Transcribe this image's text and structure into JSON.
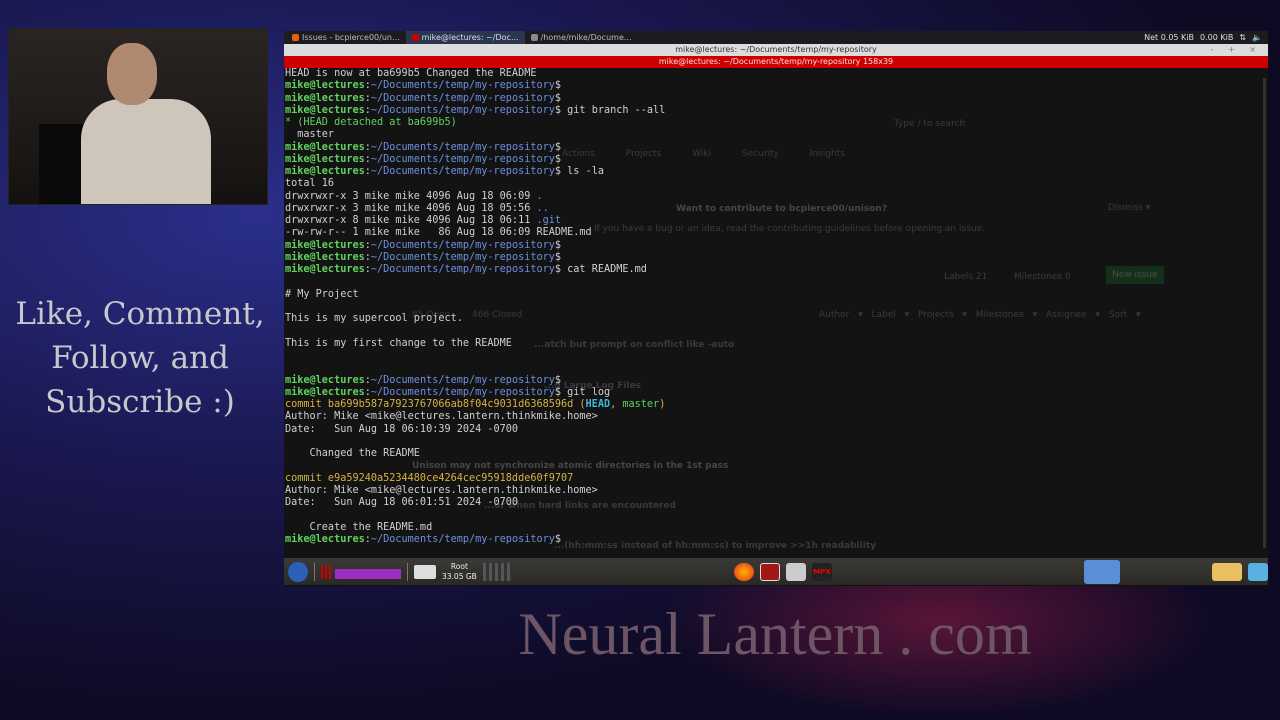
{
  "overlay": {
    "cta_lines": [
      "Like, Comment,",
      "Follow, and",
      "Subscribe :)"
    ],
    "brand": "Neural Lantern . com"
  },
  "topbar": {
    "tabs": [
      {
        "label": "Issues - bcpierce00/un...",
        "color": "#e66000"
      },
      {
        "label": "mike@lectures: ~/Doc...",
        "color": "#c00",
        "active": true
      },
      {
        "label": "/home/mike/Docume...",
        "color": "#888"
      }
    ],
    "tray": {
      "net": "Net 0.05 KiB",
      "net2": "0.00 KiB"
    }
  },
  "window": {
    "title": "mike@lectures: ~/Documents/temp/my-repository",
    "subtitle": "mike@lectures: ~/Documents/temp/my-repository 158x39",
    "controls": "- + ×"
  },
  "terminal": {
    "user": "mike@lectures",
    "path": "~/Documents/temp/my-repository",
    "lines": [
      [
        [
          "w",
          "HEAD is now at ba699b5 Changed the README"
        ]
      ],
      "P",
      "P",
      [
        "P",
        [
          "w",
          " git branch --all"
        ]
      ],
      [
        [
          "g",
          "* (HEAD detached at ba699b5)"
        ]
      ],
      [
        [
          "w",
          "  master"
        ]
      ],
      "P",
      "P",
      [
        "P",
        [
          "w",
          " ls -la"
        ]
      ],
      [
        [
          "w",
          "total 16"
        ]
      ],
      [
        [
          "w",
          "drwxrwxr-x 3 mike mike 4096 Aug 18 06:09 "
        ],
        [
          "b",
          "."
        ]
      ],
      [
        [
          "w",
          "drwxrwxr-x 3 mike mike 4096 Aug 18 05:56 "
        ],
        [
          "b",
          ".."
        ]
      ],
      [
        [
          "w",
          "drwxrwxr-x 8 mike mike 4096 Aug 18 06:11 "
        ],
        [
          "b",
          ".git"
        ]
      ],
      [
        [
          "w",
          "-rw-rw-r-- 1 mike mike   86 Aug 18 06:09 README.md"
        ]
      ],
      "P",
      "P",
      [
        "P",
        [
          "w",
          " cat README.md"
        ]
      ],
      [],
      [
        [
          "w",
          "# My Project"
        ]
      ],
      [],
      [
        [
          "w",
          "This is my supercool project."
        ]
      ],
      [],
      [
        [
          "w",
          "This is my first change to the README"
        ]
      ],
      [],
      [],
      "P",
      [
        "P",
        [
          "w",
          " git log"
        ]
      ],
      [
        [
          "y",
          "commit ba699b587a7923767066ab8f04c9031d6368596d ("
        ],
        [
          "c",
          "HEAD"
        ],
        [
          "y",
          ", "
        ],
        [
          "g",
          "master"
        ],
        [
          "y",
          ")"
        ]
      ],
      [
        [
          "w",
          "Author: Mike <mike@lectures.lantern.thinkmike.home>"
        ]
      ],
      [
        [
          "w",
          "Date:   Sun Aug 18 06:10:39 2024 -0700"
        ]
      ],
      [],
      [
        [
          "w",
          "    Changed the README"
        ]
      ],
      [],
      [
        [
          "y",
          "commit e9a59240a5234480ce4264cec95918dde60f9707"
        ]
      ],
      [
        [
          "w",
          "Author: Mike <mike@lectures.lantern.thinkmike.home>"
        ]
      ],
      [
        [
          "w",
          "Date:   Sun Aug 18 06:01:51 2024 -0700"
        ]
      ],
      [],
      [
        [
          "w",
          "    Create the README.md"
        ]
      ],
      "P"
    ]
  },
  "ghost": {
    "banner": "Want to contribute to bcpierce00/unison?",
    "banner_sub": "If you have a bug or an idea, read the contributing guidelines before opening an issue.",
    "dismiss": "Dismiss ▾",
    "search": "Type / to search",
    "nav": [
      "Actions",
      "Projects",
      "Wiki",
      "Security",
      "Insights"
    ],
    "labels": "Labels 21",
    "milestones": "Milestones 0",
    "new_issue": "New issue",
    "filters": "Author ▾   Label ▾   Projects ▾   Milestones ▾   Assignee ▾   Sort ▾",
    "open": "85 Open",
    "closed": "466 Closed",
    "issues": [
      "...atch but prompt on conflict like -auto",
      "...g Large Log Files",
      "Unison may not synchronize atomic directories in the 1st pass",
      "...or when hard links are encountered",
      "...(hh:mm:ss instead of hh:mm:ss) to improve >>1h readability"
    ]
  },
  "taskbar": {
    "disk_label": "Root",
    "disk_size": "33.05 GB"
  }
}
